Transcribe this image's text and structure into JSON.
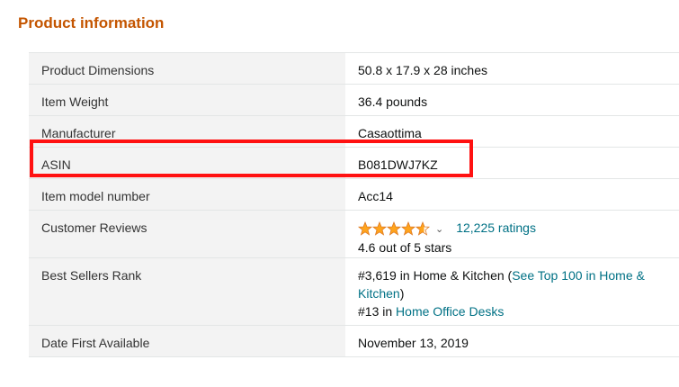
{
  "section": {
    "title": "Product information"
  },
  "rows": [
    {
      "label": "Product Dimensions",
      "value": "50.8 x 17.9 x 28 inches"
    },
    {
      "label": "Item Weight",
      "value": "36.4 pounds"
    },
    {
      "label": "Manufacturer",
      "value": "Casaottima"
    },
    {
      "label": "ASIN",
      "value": "B081DWJ7KZ"
    },
    {
      "label": "Item model number",
      "value": "Acc14"
    },
    {
      "label": "Customer Reviews",
      "ratings_link": "12,225 ratings",
      "rating_text": "4.6 out of 5 stars",
      "rating_value": 4.6
    },
    {
      "label": "Best Sellers Rank",
      "rank1_prefix": "#3,619 in Home & Kitchen (",
      "rank1_link": "See Top 100 in Home & Kitchen",
      "rank1_suffix": ")",
      "rank2_prefix": "#13 in ",
      "rank2_link": "Home Office Desks"
    },
    {
      "label": "Date First Available",
      "value": "November 13, 2019"
    }
  ],
  "colors": {
    "title": "#c45500",
    "link": "#007185",
    "star": "#ffa41c",
    "highlight": "#ff1111"
  },
  "icons": {
    "star": "star-icon",
    "chevron": "chevron-down-icon"
  }
}
